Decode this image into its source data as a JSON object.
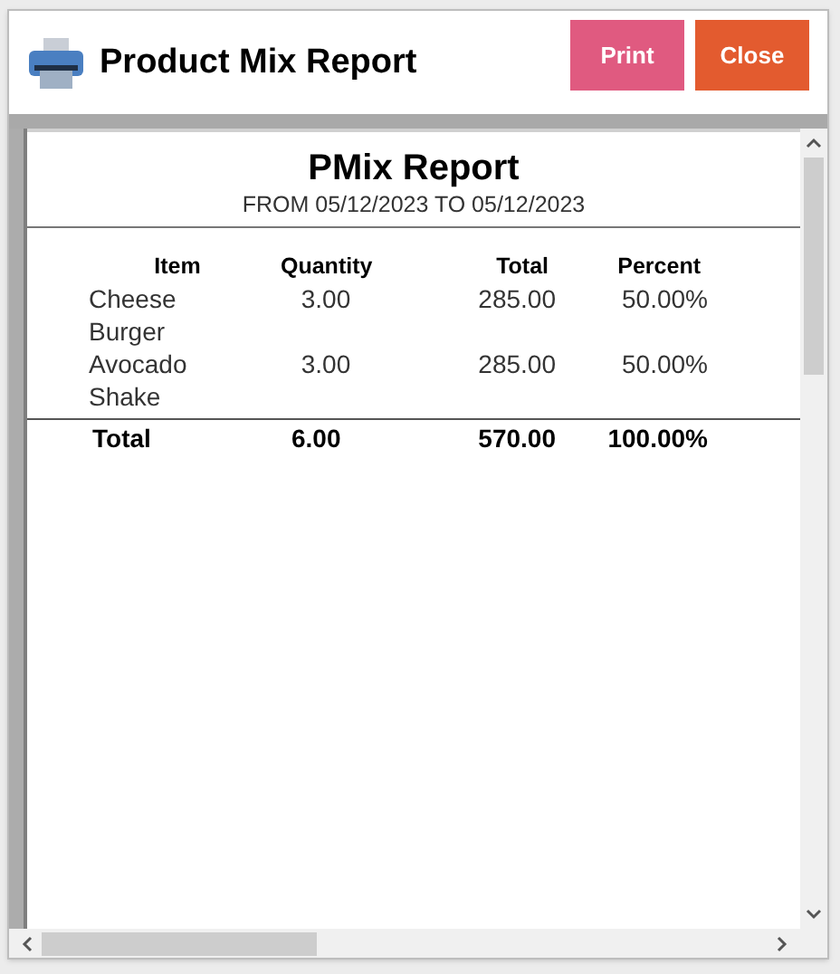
{
  "window": {
    "title": "Product Mix Report"
  },
  "buttons": [
    {
      "label": "Print",
      "kind": "print"
    },
    {
      "label": "Close",
      "kind": "close"
    }
  ],
  "report": {
    "title": "PMix Report",
    "subtitle": "FROM 05/12/2023 TO 05/12/2023",
    "columns": [
      "Item",
      "Quantity",
      "Total",
      "Percent"
    ],
    "rows": [
      {
        "item": "Cheese\nBurger",
        "quantity": "3.00",
        "total": "285.00",
        "percent": "50.00%"
      },
      {
        "item": "Avocado\nShake",
        "quantity": "3.00",
        "total": "285.00",
        "percent": "50.00%"
      }
    ],
    "totals": {
      "label": "Total",
      "quantity": "6.00",
      "total": "570.00",
      "percent": "100.00%"
    }
  }
}
